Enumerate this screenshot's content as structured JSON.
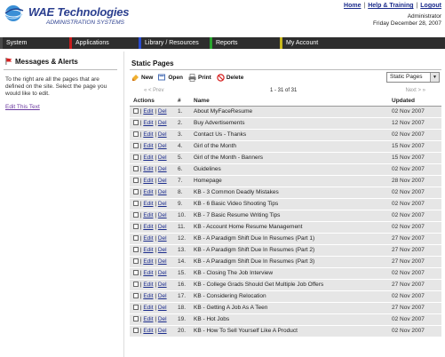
{
  "brand": {
    "name": "WAE Technologies",
    "subtitle": "ADMINISTRATION SYSTEMS"
  },
  "toplinks": {
    "home": "Home",
    "help": "Help & Training",
    "logout": "Logout",
    "sep": "|"
  },
  "user": {
    "role": "Administrator",
    "date": "Friday December 28, 2007"
  },
  "nav": [
    {
      "label": "System",
      "color": "#4a4a4a"
    },
    {
      "label": "Applications",
      "color": "#c81e1e"
    },
    {
      "label": "Library / Resources",
      "color": "#2a4bd0"
    },
    {
      "label": "Reports",
      "color": "#29a52e"
    },
    {
      "label": "My Account",
      "color": "#c8b81e"
    }
  ],
  "left": {
    "title": "Messages & Alerts",
    "text": "To the right are all the pages that are defined on the site. Select the page you would like to edit.",
    "edit_link": "Edit This Text"
  },
  "main": {
    "title": "Static Pages",
    "toolbar": {
      "new": "New",
      "open": "Open",
      "print": "Print",
      "delete": "Delete"
    },
    "select_value": "Static Pages",
    "pager": {
      "prev": "« < Prev",
      "range": "1 - 31 of 31",
      "next": "Next > »"
    },
    "columns": {
      "actions": "Actions",
      "num": "#",
      "name": "Name",
      "updated": "Updated"
    },
    "edit_label": "Edit",
    "del_label": "Del",
    "rows": [
      {
        "num": "1.",
        "name": "About MyFaceResume",
        "updated": "02 Nov 2007"
      },
      {
        "num": "2.",
        "name": "Buy Advertisements",
        "updated": "12 Nov 2007"
      },
      {
        "num": "3.",
        "name": "Contact Us - Thanks",
        "updated": "02 Nov 2007"
      },
      {
        "num": "4.",
        "name": "Girl of the Month",
        "updated": "15 Nov 2007"
      },
      {
        "num": "5.",
        "name": "Girl of the Month - Banners",
        "updated": "15 Nov 2007"
      },
      {
        "num": "6.",
        "name": "Guidelines",
        "updated": "02 Nov 2007"
      },
      {
        "num": "7.",
        "name": "Homepage",
        "updated": "28 Nov 2007"
      },
      {
        "num": "8.",
        "name": "KB - 3 Common Deadly Mistakes",
        "updated": "02 Nov 2007"
      },
      {
        "num": "9.",
        "name": "KB - 6 Basic Video Shooting Tips",
        "updated": "02 Nov 2007"
      },
      {
        "num": "10.",
        "name": "KB - 7 Basic Resume Writing Tips",
        "updated": "02 Nov 2007"
      },
      {
        "num": "11.",
        "name": "KB - Account Home Resume Management",
        "updated": "02 Nov 2007"
      },
      {
        "num": "12.",
        "name": "KB - A Paradigm Shift Due In Resumes (Part 1)",
        "updated": "27 Nov 2007"
      },
      {
        "num": "13.",
        "name": "KB - A Paradigm Shift Due In Resumes (Part 2)",
        "updated": "27 Nov 2007"
      },
      {
        "num": "14.",
        "name": "KB - A Paradigm Shift Due In Resumes (Part 3)",
        "updated": "27 Nov 2007"
      },
      {
        "num": "15.",
        "name": "KB - Closing The Job Interview",
        "updated": "02 Nov 2007"
      },
      {
        "num": "16.",
        "name": "KB - College Grads Should Get Multiple Job Offers",
        "updated": "27 Nov 2007"
      },
      {
        "num": "17.",
        "name": "KB - Considering Relocation",
        "updated": "02 Nov 2007"
      },
      {
        "num": "18.",
        "name": "KB - Getting A Job As A Teen",
        "updated": "27 Nov 2007"
      },
      {
        "num": "19.",
        "name": "KB - Hot Jobs",
        "updated": "02 Nov 2007"
      },
      {
        "num": "20.",
        "name": "KB - How To Sell Yourself Like A Product",
        "updated": "02 Nov 2007"
      }
    ]
  }
}
